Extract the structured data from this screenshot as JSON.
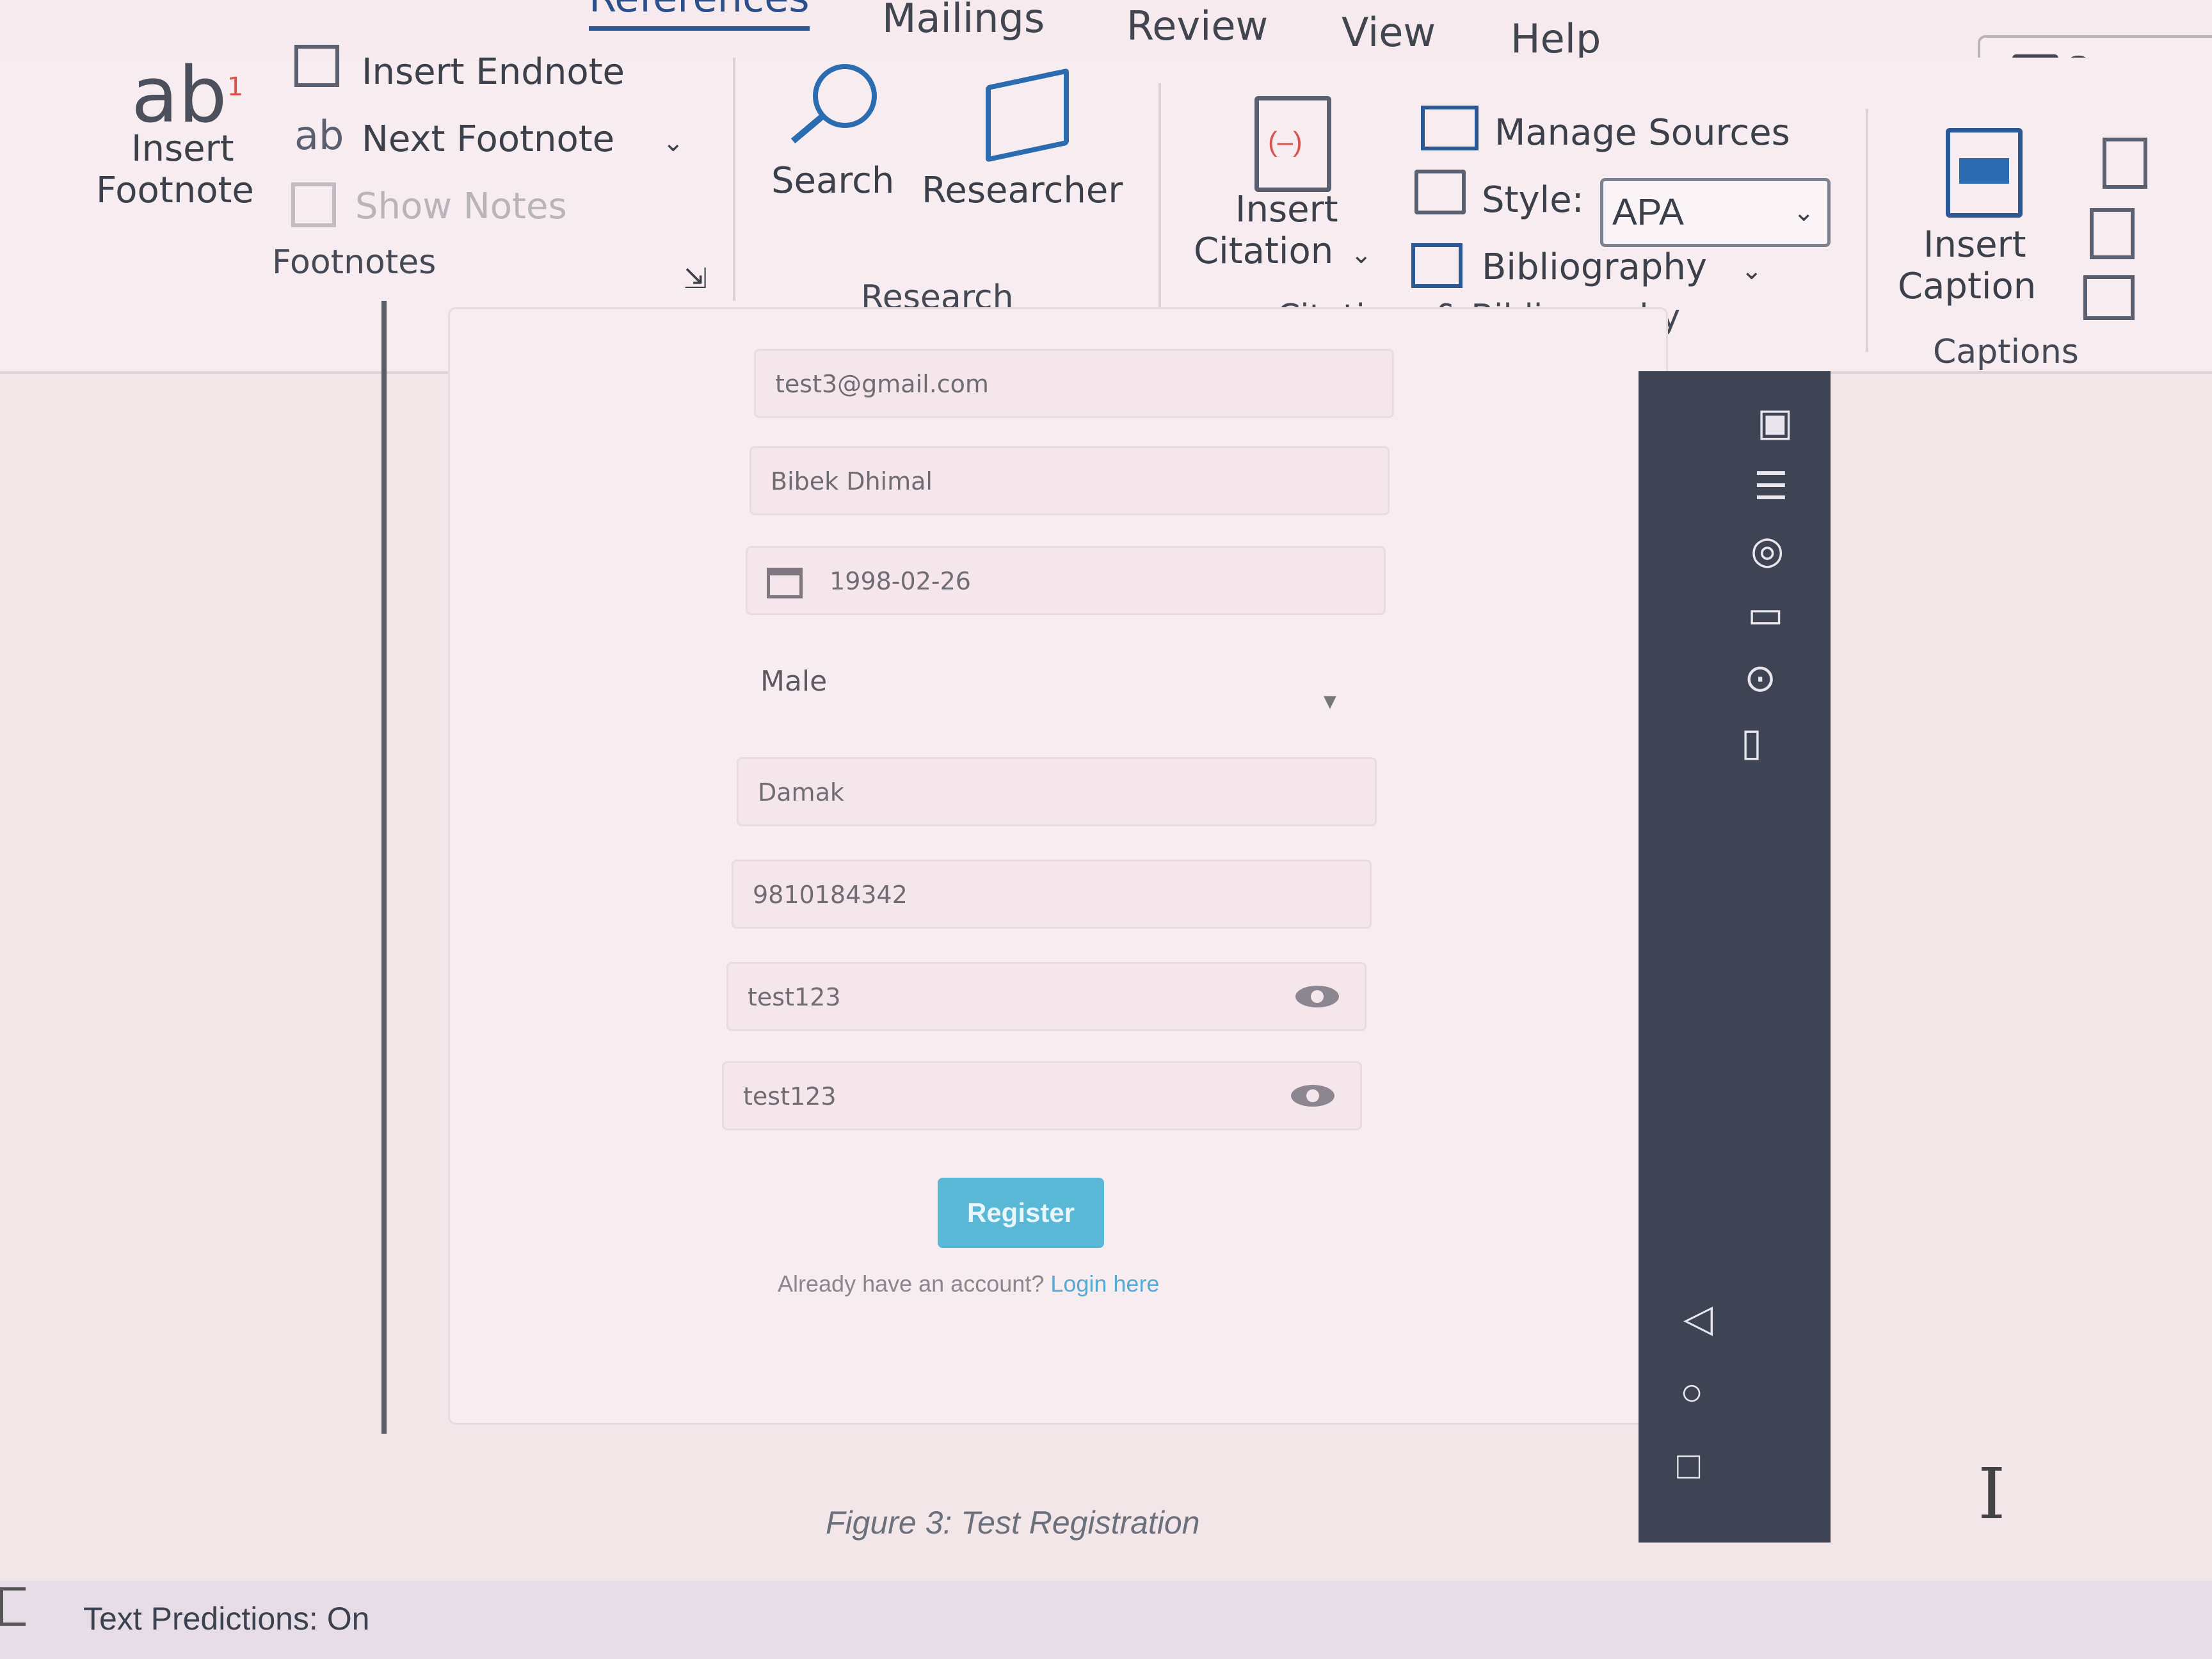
{
  "tabs": [
    "References",
    "Mailings",
    "Review",
    "View",
    "Help"
  ],
  "comments_label": "Comme",
  "footnotes": {
    "insert_footnote_line1": "Insert",
    "insert_footnote_line2": "Footnote",
    "insert_endnote": "Insert Endnote",
    "next_footnote": "Next Footnote",
    "show_notes": "Show Notes",
    "group_label": "Footnotes"
  },
  "research": {
    "search": "Search",
    "researcher": "Researcher",
    "group_label": "Research"
  },
  "citations": {
    "insert_citation_line1": "Insert",
    "insert_citation_line2": "Citation",
    "manage_sources": "Manage Sources",
    "style_label": "Style:",
    "style_value": "APA",
    "bibliography": "Bibliography",
    "group_label": "Citations & Bibliography"
  },
  "captions": {
    "insert_caption_line1": "Insert",
    "insert_caption_line2": "Caption",
    "group_label": "Captions"
  },
  "form": {
    "email": "test3@gmail.com",
    "name": "Bibek Dhimal",
    "dob": "1998-02-26",
    "gender": "Male",
    "address": "Damak",
    "phone": "9810184342",
    "password": "test123",
    "confirm_password": "test123",
    "register_label": "Register",
    "login_prompt": "Already have an account?",
    "login_link": "Login here"
  },
  "figure_caption": "Figure 3: Test Registration",
  "status": {
    "text_predictions": "Text Predictions: On"
  },
  "icons": [
    "footnote-icon",
    "endnote-icon",
    "next-footnote-icon",
    "show-notes-icon",
    "search-icon",
    "researcher-icon",
    "insert-citation-icon",
    "manage-sources-icon",
    "style-icon",
    "bibliography-icon",
    "insert-caption-icon",
    "calendar-icon",
    "eye-icon",
    "back-icon",
    "home-icon",
    "recents-icon"
  ]
}
